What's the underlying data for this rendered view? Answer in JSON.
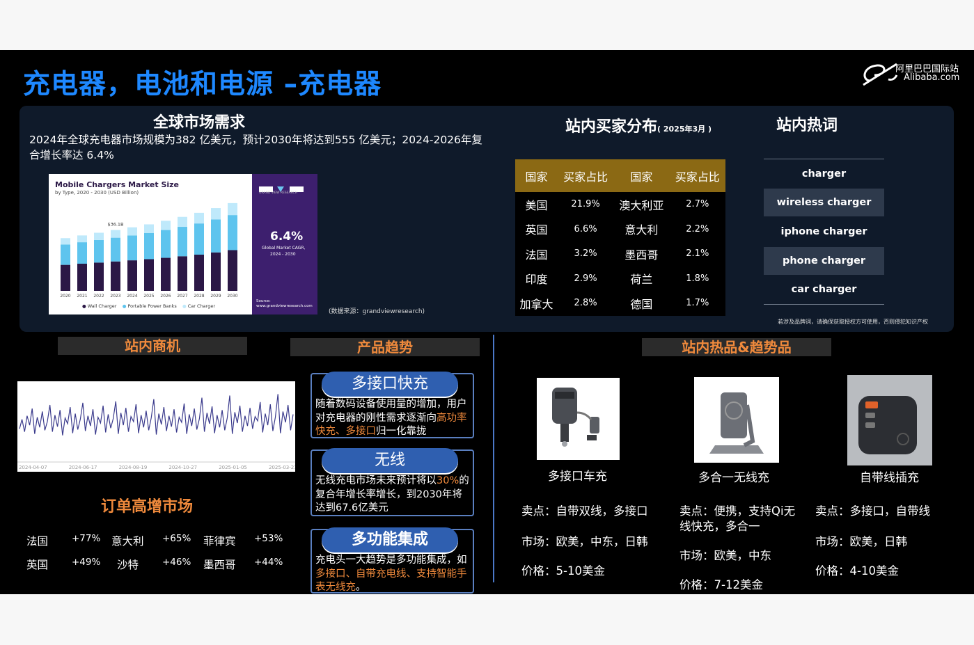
{
  "title": "充电器，电池和电源 –充电器",
  "logo": {
    "cn": "阿里巴巴国际站",
    "en": "Alibaba.com"
  },
  "market": {
    "heading": "全球市场需求",
    "intro": "2024年全球充电器市场规模为382 亿美元，预计2030年将达到555 亿美元；2024-2026年复合增长率达 6.4%",
    "chart_title": "Mobile Chargers Market Size",
    "chart_subtitle": "by Type, 2020 - 2030 (USD Billion)",
    "bar_label": "$36.1B",
    "brand": "GRAND VIEW RESEARCH",
    "cagr": "6.4%",
    "cagr_label": "Global Market CAGR,",
    "cagr_years": "2024 - 2030",
    "source_label": "Source:",
    "source_url": "www.grandviewresearch.com",
    "legend": [
      "Wall Charger",
      "Portable Power Banks",
      "Car Charger"
    ],
    "source_note": "(数据来源：grandviewresearch)"
  },
  "chart_data": [
    {
      "type": "bar",
      "title": "Mobile Chargers Market Size",
      "subtitle": "by Type, 2020 - 2030 (USD Billion)",
      "categories": [
        "2020",
        "2021",
        "2022",
        "2023",
        "2024",
        "2025",
        "2026",
        "2027",
        "2028",
        "2029",
        "2030"
      ],
      "series": [
        {
          "name": "Wall Charger",
          "color": "#2b1846",
          "values": [
            11.5,
            12.0,
            12.5,
            13.0,
            13.5,
            14.0,
            14.6,
            15.3,
            16.0,
            17.0,
            18.0
          ]
        },
        {
          "name": "Portable Power Banks",
          "color": "#5ec4ee",
          "values": [
            9.0,
            9.5,
            10.0,
            10.5,
            11.0,
            11.6,
            12.3,
            13.0,
            13.8,
            14.6,
            15.5
          ]
        },
        {
          "name": "Car Charger",
          "color": "#bfe9fb",
          "values": [
            2.8,
            3.0,
            3.2,
            3.4,
            3.6,
            3.8,
            4.1,
            4.4,
            4.7,
            5.0,
            5.3
          ]
        }
      ],
      "annotation": "$36.1B"
    },
    {
      "type": "line",
      "xticks": [
        "2024-04-07",
        "2024-06-17",
        "2024-08-19",
        "2024-10-27",
        "2025-01-05",
        "2025-03-21"
      ],
      "ylim": [
        0,
        100
      ],
      "values": [
        42,
        55,
        38,
        60,
        47,
        70,
        35,
        58,
        44,
        66,
        40,
        52,
        75,
        38,
        61,
        45,
        68,
        33,
        57,
        49,
        72,
        36,
        63,
        41,
        55,
        78,
        39,
        60,
        46,
        69,
        34,
        58,
        50,
        74,
        37,
        62,
        43,
        56,
        80,
        35,
        64,
        47,
        71,
        38,
        59,
        52,
        76,
        36,
        61,
        44,
        67,
        40,
        57,
        83,
        34,
        63,
        48,
        72,
        39,
        60,
        45,
        69,
        37,
        58,
        51,
        77,
        35,
        62,
        46,
        70,
        41,
        56,
        85,
        38,
        64,
        49,
        73,
        36,
        61,
        44,
        68,
        40,
        57,
        88,
        35,
        65,
        50,
        74,
        38,
        60,
        46,
        71,
        42,
        59,
        53,
        79,
        37,
        63,
        47,
        76,
        39,
        58,
        90,
        36,
        66,
        51,
        75,
        40,
        62
      ]
    }
  ],
  "buyers": {
    "heading": "站内买家分布",
    "heading_note": "( 2025年3月 )",
    "headers": [
      "国家",
      "买家占比",
      "国家",
      "买家占比"
    ],
    "rows": [
      [
        "美国",
        "21.9%",
        "澳大利亚",
        "2.7%"
      ],
      [
        "英国",
        "6.6%",
        "意大利",
        "2.2%"
      ],
      [
        "法国",
        "3.2%",
        "墨西哥",
        "2.1%"
      ],
      [
        "印度",
        "2.9%",
        "荷兰",
        "1.8%"
      ],
      [
        "加拿大",
        "2.8%",
        "德国",
        "1.7%"
      ]
    ]
  },
  "hotwords": {
    "heading": "站内热词",
    "items": [
      "charger",
      "wireless charger",
      "iphone charger",
      "phone charger",
      "car charger"
    ],
    "notice": "若涉及品牌词，请确保获取授权方可使用，否则侵犯知识产权"
  },
  "opportunity": {
    "heading": "站内商机",
    "orders_heading": "订单高增市场",
    "markets": [
      [
        "法国",
        "+77%",
        "意大利",
        "+65%",
        "菲律宾",
        "+53%"
      ],
      [
        "英国",
        "+49%",
        "沙特",
        "+46%",
        "墨西哥",
        "+44%"
      ]
    ]
  },
  "trends": {
    "heading": "产品趋势",
    "cards": [
      {
        "title": "多接口快充",
        "text_a": "随着数码设备使用量的增加，用户对充电器的刚性需求逐渐向",
        "text_b": "高功率快充、多接口",
        "text_c": "归一化靠拢"
      },
      {
        "title": "无线",
        "text_a": "无线充电市场未来预计将以",
        "text_b": "30%",
        "text_c": "的复合年增长率增长，到2030年将达到67.6亿美元"
      },
      {
        "title": "多功能集成",
        "text_a": "充电头一大趋势是多功能集成，如",
        "text_b": "多接口、自带充电线、支持智能手表无线充",
        "text_c": "。"
      }
    ]
  },
  "hot_products": {
    "heading": "站内热品&趋势品",
    "items": [
      {
        "name": "多接口车充",
        "points": "卖点：自带双线，多接口",
        "market": "市场：欧美，中东，日韩",
        "price": "价格：5-10美金"
      },
      {
        "name": "多合一无线充",
        "points": "卖点：便携，支持Qi无线快充，多合一",
        "market": "市场：欧美，中东",
        "price": "价格：7-12美金"
      },
      {
        "name": "自带线插充",
        "points": "卖点：多接口，自带线",
        "market": "市场：欧美，日韩",
        "price": "价格：4-10美金"
      }
    ]
  }
}
